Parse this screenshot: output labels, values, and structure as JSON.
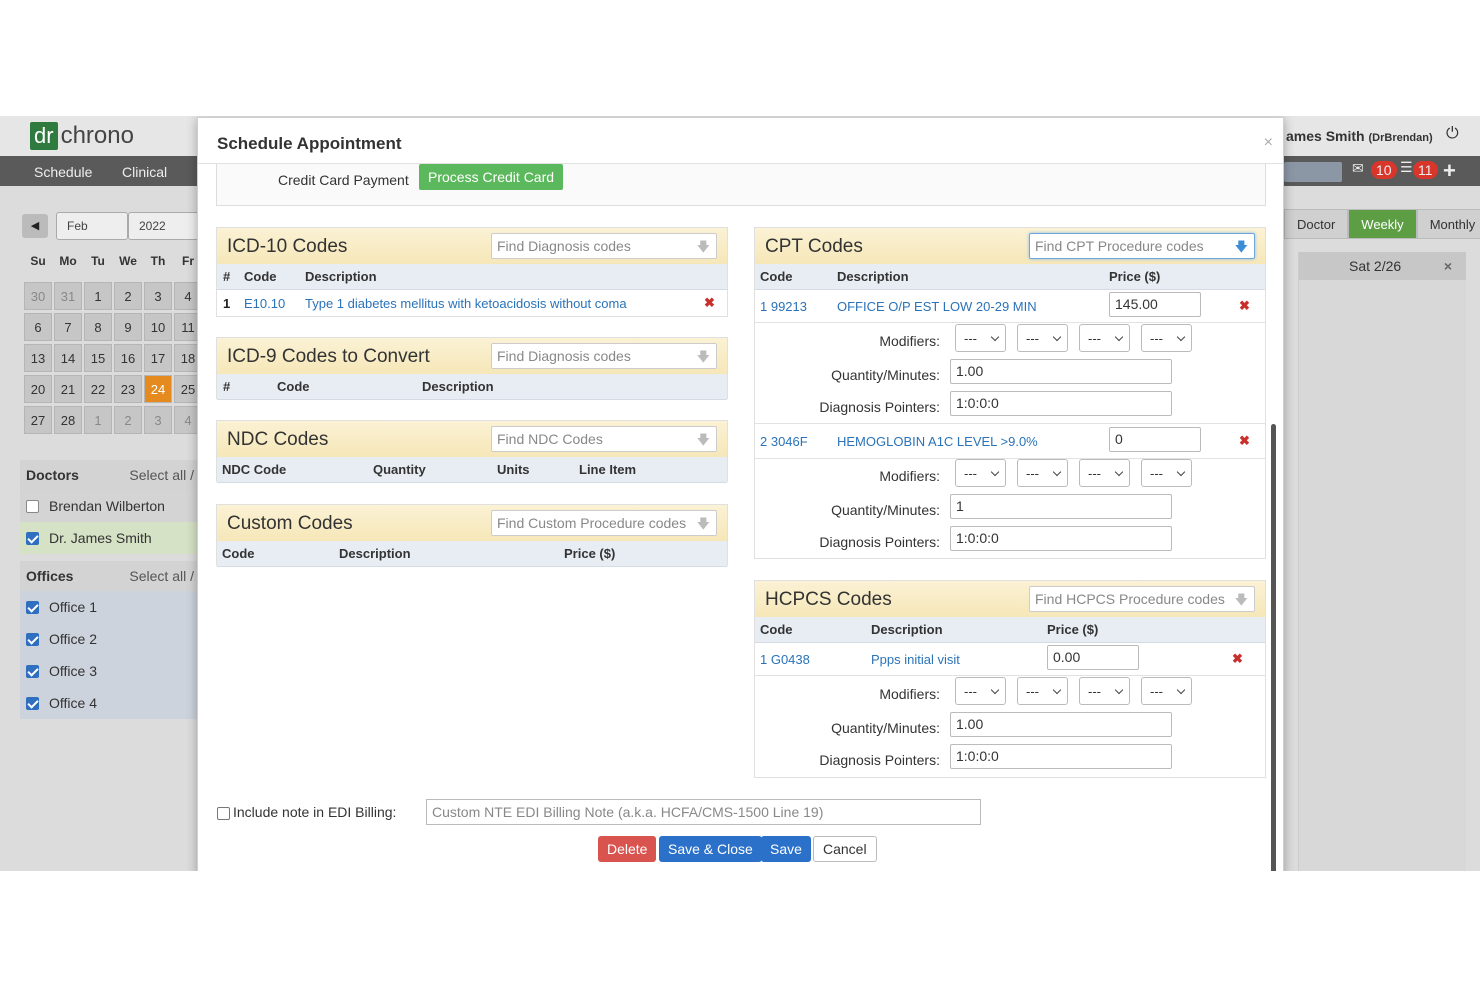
{
  "app": {
    "logo_dr": "dr",
    "logo_chrono": "chrono",
    "nav": [
      "Schedule",
      "Clinical"
    ],
    "user_name": "ames Smith",
    "user_handle": "(DrBrendan)",
    "badges": {
      "mail": "10",
      "tasks": "11"
    },
    "calendar": {
      "month": "Feb",
      "year": "2022",
      "weekdays": [
        "Su",
        "Mo",
        "Tu",
        "We",
        "Th",
        "Fr"
      ],
      "weeks": [
        [
          "30",
          "31",
          "1",
          "2",
          "3",
          "4"
        ],
        [
          "6",
          "7",
          "8",
          "9",
          "10",
          "11"
        ],
        [
          "13",
          "14",
          "15",
          "16",
          "17",
          "18"
        ],
        [
          "20",
          "21",
          "22",
          "23",
          "24",
          "25"
        ],
        [
          "27",
          "28",
          "1",
          "2",
          "3",
          "4"
        ]
      ],
      "today": "24"
    },
    "doctors": {
      "title": "Doctors",
      "select_all": "Select all /",
      "items": [
        {
          "name": "Brendan Wilberton",
          "checked": false
        },
        {
          "name": "Dr. James Smith",
          "checked": true
        }
      ]
    },
    "offices": {
      "title": "Offices",
      "select_all": "Select all /",
      "items": [
        "Office 1",
        "Office 2",
        "Office 3",
        "Office 4"
      ]
    },
    "view_tabs": [
      "Doctor",
      "Weekly",
      "Monthly"
    ],
    "active_view": "Weekly",
    "day_header": "Sat 2/26"
  },
  "modal": {
    "title": "Schedule Appointment",
    "credit_card_label": "Credit Card Payment",
    "credit_card_button": "Process Credit Card",
    "icd10": {
      "title": "ICD-10 Codes",
      "placeholder": "Find Diagnosis codes",
      "headers": [
        "#",
        "Code",
        "Description"
      ],
      "rows": [
        {
          "num": "1",
          "code": "E10.10",
          "description": "Type 1 diabetes mellitus with ketoacidosis without coma"
        }
      ]
    },
    "icd9": {
      "title": "ICD-9 Codes to Convert",
      "placeholder": "Find Diagnosis codes",
      "headers": [
        "#",
        "Code",
        "Description"
      ]
    },
    "ndc": {
      "title": "NDC Codes",
      "placeholder": "Find NDC Codes",
      "headers": [
        "NDC Code",
        "Quantity",
        "Units",
        "Line Item"
      ]
    },
    "custom": {
      "title": "Custom Codes",
      "placeholder": "Find Custom Procedure codes",
      "headers": [
        "Code",
        "Description",
        "Price ($)"
      ]
    },
    "cpt": {
      "title": "CPT Codes",
      "placeholder": "Find CPT Procedure codes",
      "headers": [
        "Code",
        "Description",
        "Price ($)"
      ],
      "rows": [
        {
          "code": "1 99213",
          "description": "OFFICE O/P EST LOW 20-29 MIN",
          "price": "145.00",
          "quantity": "1.00",
          "pointers": "1:0:0:0"
        },
        {
          "code": "2 3046F",
          "description": "HEMOGLOBIN A1C LEVEL >9.0%",
          "price": "0",
          "quantity": "1",
          "pointers": "1:0:0:0"
        }
      ]
    },
    "hcpcs": {
      "title": "HCPCS Codes",
      "placeholder": "Find HCPCS Procedure codes",
      "headers": [
        "Code",
        "Description",
        "Price ($)"
      ],
      "rows": [
        {
          "code": "1 G0438",
          "description": "Ppps initial visit",
          "price": "0.00",
          "quantity": "1.00",
          "pointers": "1:0:0:0"
        }
      ]
    },
    "labels": {
      "modifiers": "Modifiers:",
      "quantity": "Quantity/Minutes:",
      "pointers": "Diagnosis Pointers:",
      "modifier_option": "---"
    },
    "edi_label": "Include note in EDI Billing:",
    "edi_placeholder": "Custom NTE EDI Billing Note (a.k.a. HCFA/CMS-1500 Line 19)",
    "buttons": {
      "delete": "Delete",
      "save_close": "Save & Close",
      "save": "Save",
      "cancel": "Cancel"
    }
  }
}
